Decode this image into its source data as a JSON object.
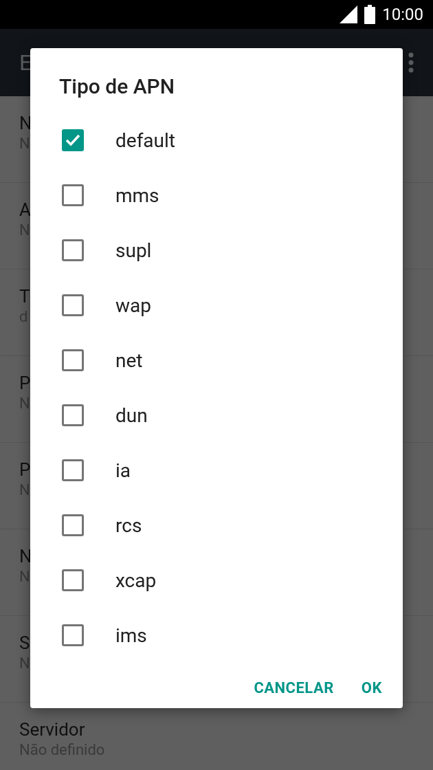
{
  "status_bar": {
    "time": "10:00"
  },
  "app_bar": {
    "title": "E"
  },
  "settings": [
    {
      "title": "N",
      "value": "N"
    },
    {
      "title": "A",
      "value": "N"
    },
    {
      "title": "T",
      "value": "d"
    },
    {
      "title": "P",
      "value": "N"
    },
    {
      "title": "P",
      "value": "N"
    },
    {
      "title": "N",
      "value": "N"
    },
    {
      "title": "S",
      "value": "N"
    },
    {
      "title": "Servidor",
      "value": "Não definido"
    }
  ],
  "dialog": {
    "title": "Tipo de APN",
    "options": [
      {
        "label": "default",
        "checked": true
      },
      {
        "label": "mms",
        "checked": false
      },
      {
        "label": "supl",
        "checked": false
      },
      {
        "label": "wap",
        "checked": false
      },
      {
        "label": "net",
        "checked": false
      },
      {
        "label": "dun",
        "checked": false
      },
      {
        "label": "ia",
        "checked": false
      },
      {
        "label": "rcs",
        "checked": false
      },
      {
        "label": "xcap",
        "checked": false
      },
      {
        "label": "ims",
        "checked": false
      }
    ],
    "buttons": [
      "CANCELAR",
      "OK"
    ]
  }
}
